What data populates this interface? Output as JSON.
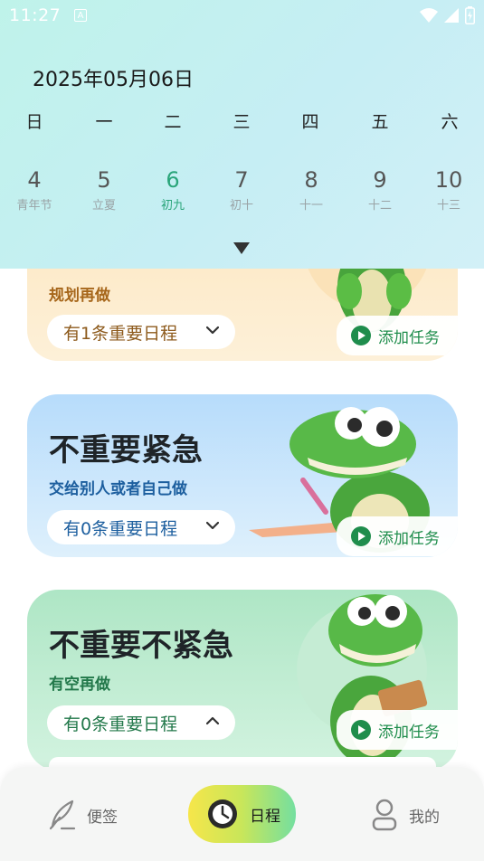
{
  "status_bar": {
    "time": "11:27",
    "notification_glyph": "A"
  },
  "calendar": {
    "current_date": "2025年05月06日",
    "weekdays": [
      "日",
      "一",
      "二",
      "三",
      "四",
      "五",
      "六"
    ],
    "days": [
      {
        "num": "4",
        "lunar": "青年节"
      },
      {
        "num": "5",
        "lunar": "立夏"
      },
      {
        "num": "6",
        "lunar": "初九"
      },
      {
        "num": "7",
        "lunar": "初十"
      },
      {
        "num": "8",
        "lunar": "十一"
      },
      {
        "num": "9",
        "lunar": "十二"
      },
      {
        "num": "10",
        "lunar": "十三"
      }
    ],
    "selected_day": "6"
  },
  "cards": [
    {
      "title": "",
      "subtitle": "规划再做",
      "count_label": "有1条重要日程",
      "add_label": "添加任务"
    },
    {
      "title": "不重要紧急",
      "subtitle": "交给别人或者自己做",
      "count_label": "有0条重要日程",
      "add_label": "添加任务"
    },
    {
      "title": "不重要不紧急",
      "subtitle": "有空再做",
      "count_label": "有0条重要日程",
      "add_label": "添加任务"
    }
  ],
  "bottom_nav": {
    "items": [
      {
        "label": "便签",
        "icon": "quill-icon"
      },
      {
        "label": "日程",
        "icon": "clock-icon"
      },
      {
        "label": "我的",
        "icon": "user-icon"
      }
    ],
    "active": "日程"
  },
  "colors": {
    "accent_green": "#2aa57a",
    "card_orange": "#fde9c6",
    "card_blue": "#b7dcfb",
    "card_green": "#aee6c5"
  }
}
